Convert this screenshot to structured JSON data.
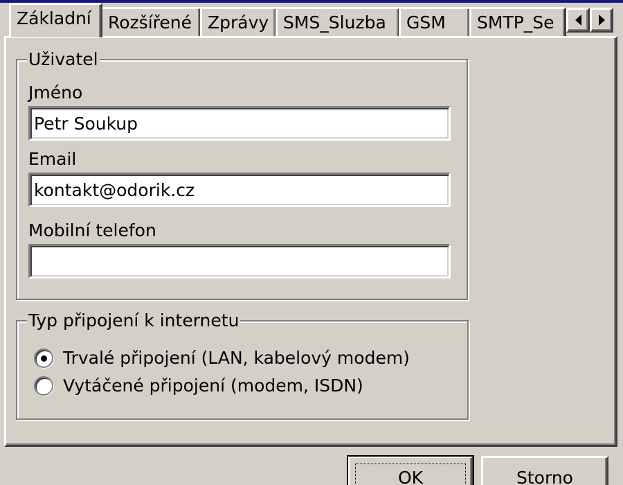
{
  "tabs": {
    "items": [
      {
        "label": "Základní",
        "active": true
      },
      {
        "label": "Rozšířené",
        "active": false
      },
      {
        "label": "Zprávy",
        "active": false
      },
      {
        "label": "SMS_Sluzba",
        "active": false
      },
      {
        "label": "GSM",
        "active": false
      },
      {
        "label": "SMTP_Se",
        "active": false
      }
    ],
    "scroll_left_icon": "arrow-left-icon",
    "scroll_right_icon": "arrow-right-icon"
  },
  "user_group": {
    "legend": "Uživatel",
    "name_label": "Jméno",
    "name_value": "Petr Soukup",
    "email_label": "Email",
    "email_value": "kontakt@odorik.cz",
    "phone_label": "Mobilní telefon",
    "phone_value": ""
  },
  "connection_group": {
    "legend": "Typ připojení k internetu",
    "options": [
      {
        "label": "Trvalé připojení (LAN, kabelový modem)",
        "checked": true
      },
      {
        "label": "Vytáčené připojení (modem, ISDN)",
        "checked": false
      }
    ]
  },
  "buttons": {
    "ok_label": "OK",
    "cancel_label": "Storno"
  },
  "colors": {
    "face": "#d4d0c8",
    "highlight": "#ffffff",
    "shadow": "#808080",
    "dark_shadow": "#404040",
    "title_strip": "#1a1a6c"
  }
}
